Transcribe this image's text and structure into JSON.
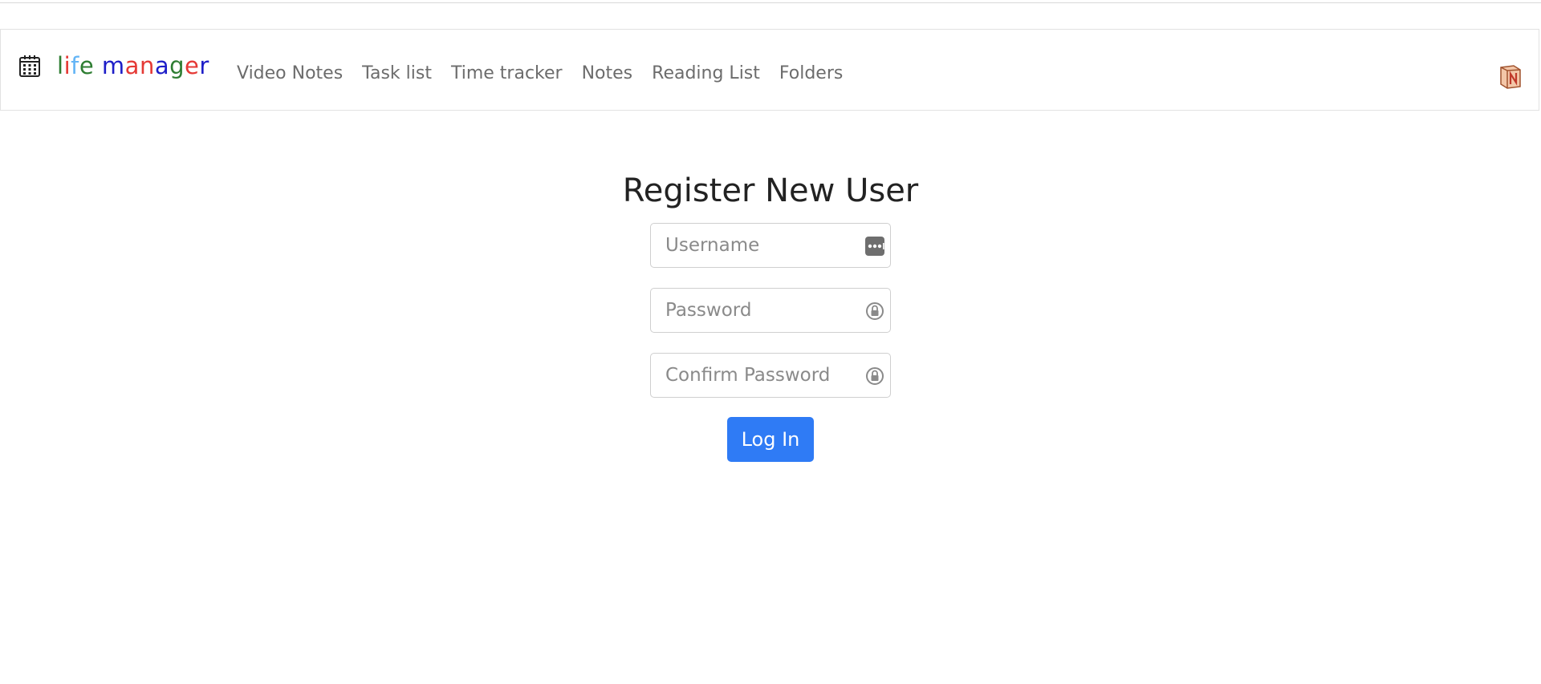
{
  "brand": {
    "letters": [
      {
        "char": "l",
        "color": "#2e7d32"
      },
      {
        "char": "i",
        "color": "#e53935"
      },
      {
        "char": "f",
        "color": "#64b5f6"
      },
      {
        "char": "e",
        "color": "#2e7d32"
      },
      {
        "char": " ",
        "color": "#000000"
      },
      {
        "char": "m",
        "color": "#1e1ec8"
      },
      {
        "char": "a",
        "color": "#e53935"
      },
      {
        "char": "n",
        "color": "#e53935"
      },
      {
        "char": "a",
        "color": "#1e1ec8"
      },
      {
        "char": "g",
        "color": "#2e7d32"
      },
      {
        "char": "e",
        "color": "#e53935"
      },
      {
        "char": "r",
        "color": "#1e1ec8"
      }
    ],
    "icon": "calendar-icon"
  },
  "nav": {
    "items": [
      {
        "label": "Video Notes"
      },
      {
        "label": "Task list"
      },
      {
        "label": "Time tracker"
      },
      {
        "label": "Notes"
      },
      {
        "label": "Reading List"
      },
      {
        "label": "Folders"
      }
    ],
    "right_icon": "notion-icon"
  },
  "form": {
    "title": "Register New User",
    "username": {
      "placeholder": "Username",
      "value": "",
      "icon": "password-manager-icon"
    },
    "password": {
      "placeholder": "Password",
      "value": "",
      "icon": "password-lock-icon"
    },
    "confirm": {
      "placeholder": "Confirm Password",
      "value": "",
      "icon": "password-lock-icon"
    },
    "submit_label": "Log In",
    "accent": "#2f7bf5"
  }
}
